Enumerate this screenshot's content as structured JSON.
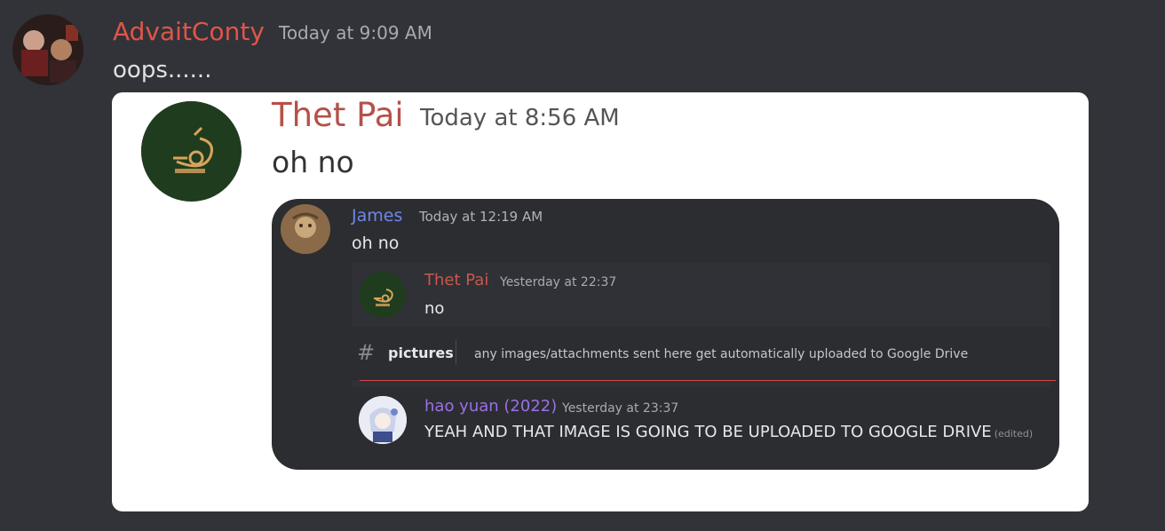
{
  "message": {
    "author": "AdvaitConty",
    "timestamp": "Today at 9:09 AM",
    "text": "oops......",
    "avatar_icon": "user-avatar-icon"
  },
  "screenshot": {
    "author": "Thet Pai",
    "timestamp": "Today at 8:56 AM",
    "text": "oh no",
    "reply": {
      "author": "James",
      "timestamp": "Today at 12:19 AM",
      "text": "oh no",
      "quoted": {
        "author": "Thet Pai",
        "timestamp": "Yesterday at 22:37",
        "text": "no"
      },
      "channel": {
        "icon": "hash-icon",
        "name": "pictures",
        "topic": "any images/attachments sent here get automatically uploaded to Google Drive"
      },
      "followup": {
        "author": "hao yuan (2022)",
        "timestamp": "Yesterday at 23:37",
        "text": "YEAH AND THAT IMAGE IS GOING TO BE UPLOADED TO GOOGLE DRIVE",
        "edited": "(edited)"
      }
    }
  },
  "colors": {
    "background": "#313338",
    "author_advait": "#e0554a",
    "author_thet": "#b5514a",
    "author_james": "#6f87e8",
    "author_hao": "#9b71e6",
    "new_messages_line": "#d24b4b"
  }
}
